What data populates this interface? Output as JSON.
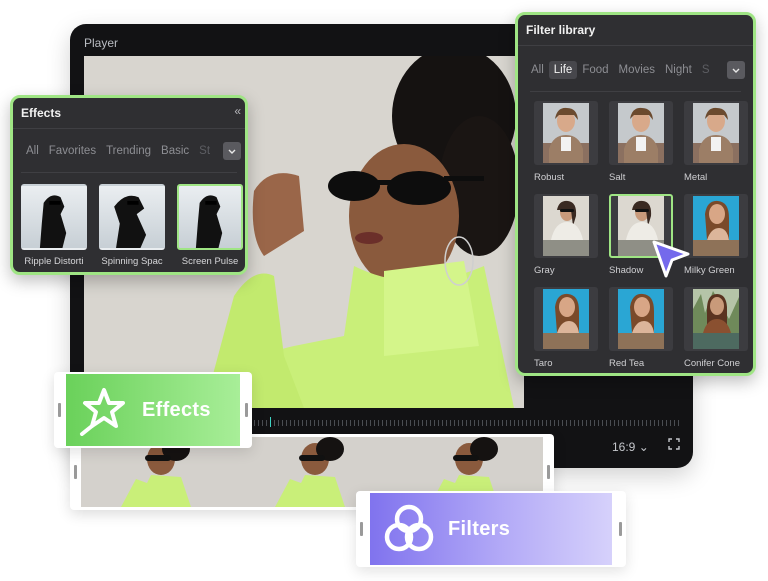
{
  "player": {
    "title": "Player",
    "aspect_ratio": "16:9",
    "aspect_chevron": "⌄"
  },
  "effects_panel": {
    "title": "Effects",
    "collapse_glyph": "«",
    "tabs": [
      "All",
      "Favorites",
      "Trending",
      "Basic",
      "St"
    ],
    "items": [
      {
        "label": "Ripple Distorti",
        "selected": false
      },
      {
        "label": "Spinning Spac",
        "selected": false
      },
      {
        "label": "Screen Pulse",
        "selected": true
      }
    ]
  },
  "filter_panel": {
    "title": "Filter library",
    "tabs": [
      "All",
      "Life",
      "Food",
      "Movies",
      "Night",
      "S"
    ],
    "active_tab": "Life",
    "items": [
      {
        "label": "Robust",
        "selected": false,
        "style": "man"
      },
      {
        "label": "Salt",
        "selected": false,
        "style": "man"
      },
      {
        "label": "Metal",
        "selected": false,
        "style": "man"
      },
      {
        "label": "Gray",
        "selected": false,
        "style": "woman-white"
      },
      {
        "label": "Shadow",
        "selected": true,
        "style": "woman-white"
      },
      {
        "label": "Milky Green",
        "selected": false,
        "style": "woman-blue"
      },
      {
        "label": "Taro",
        "selected": false,
        "style": "woman-blue"
      },
      {
        "label": "Red Tea",
        "selected": false,
        "style": "woman-blue"
      },
      {
        "label": "Conifer Cone",
        "selected": false,
        "style": "woman-forest"
      }
    ]
  },
  "effects_chip": {
    "label": "Effects",
    "icon": "star-wand-icon"
  },
  "filters_chip": {
    "label": "Filters",
    "icon": "three-circles-icon"
  },
  "colors": {
    "accent_green": "#9fe584",
    "accent_purple": "#8073ee",
    "panel_bg": "#2f2f32",
    "player_bg": "#121214",
    "timeline_cursor": "#3fd4c4"
  }
}
